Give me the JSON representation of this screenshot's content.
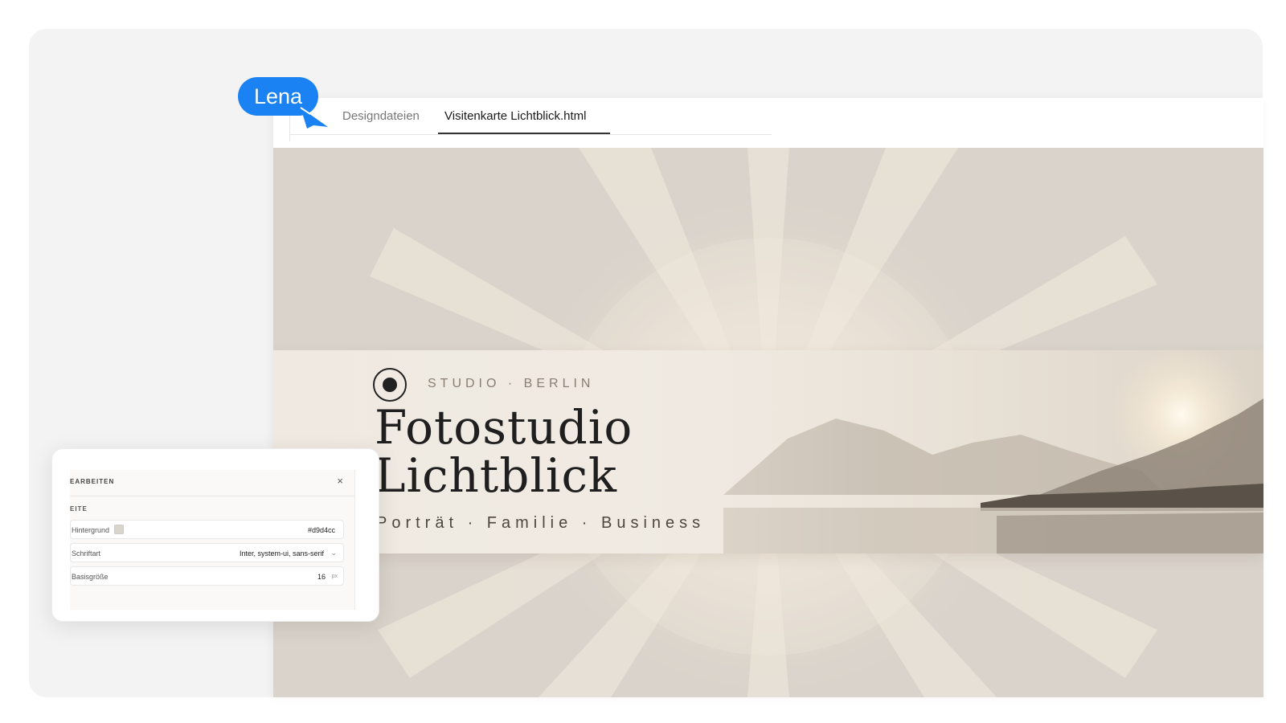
{
  "collaborator": {
    "name": "Lena"
  },
  "tabs": [
    {
      "label": "Designdateien"
    },
    {
      "label": "Visitenkarte Lichtblick.html",
      "active": true
    }
  ],
  "card": {
    "kicker": "STUDIO · BERLIN",
    "title_line1": "Fotostudio",
    "title_line2": "Lichtblick",
    "tagline": "Porträt · Familie · Business",
    "background_color": "#d9d3cb"
  },
  "panel": {
    "title": "EARBEITEN",
    "close": "×",
    "section": "EITE",
    "rows": [
      {
        "label": "Hintergrund",
        "value": "#d9d4cc",
        "swatch": "#d9d4cc"
      },
      {
        "label": "Schriftart",
        "value": "Inter, system-ui, sans-serif",
        "chevron": "⌄"
      },
      {
        "label": "Basisgröße",
        "value": "16",
        "unit": "px"
      }
    ]
  },
  "colors": {
    "accent": "#1a82f2"
  }
}
